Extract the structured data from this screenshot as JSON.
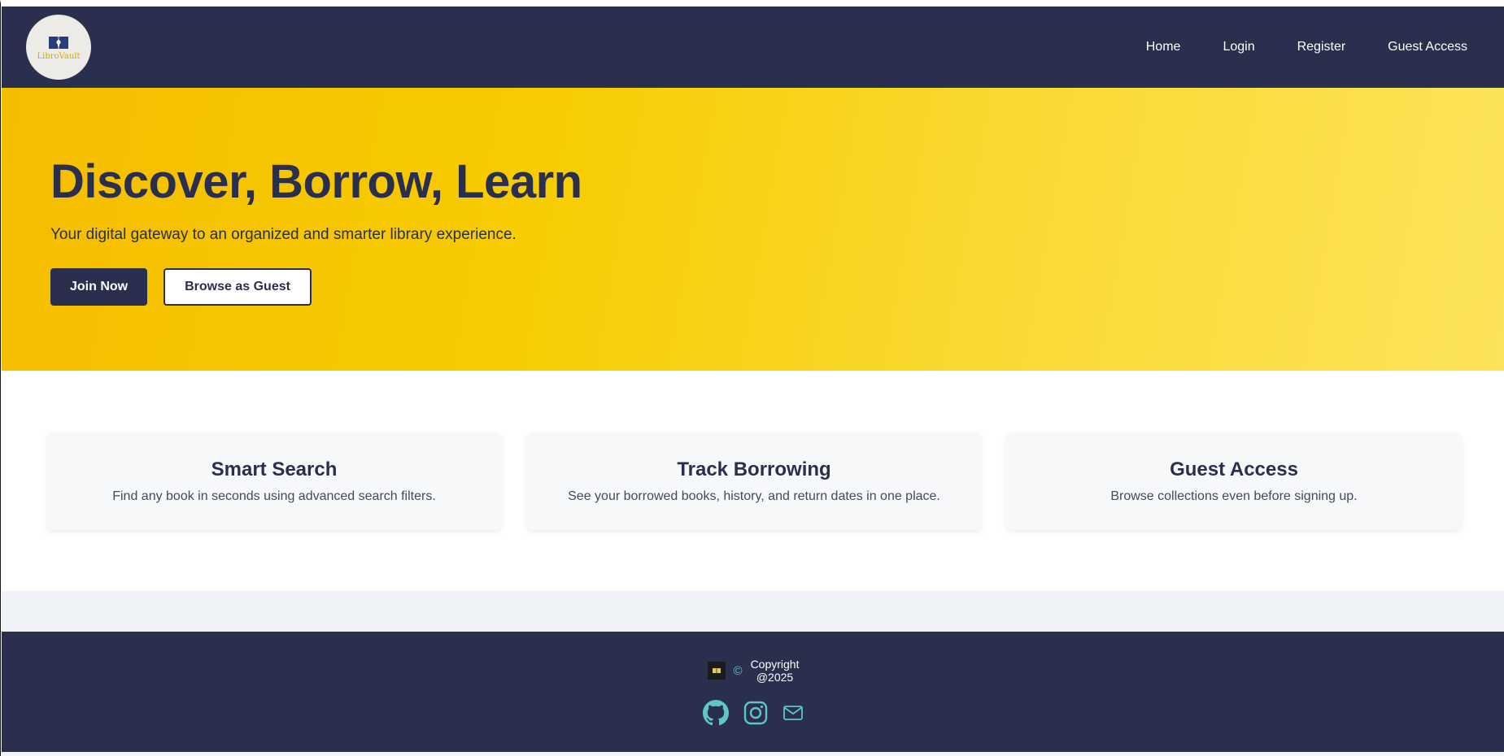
{
  "header": {
    "logo_text": "LibroVault",
    "nav": [
      {
        "label": "Home"
      },
      {
        "label": "Login"
      },
      {
        "label": "Register"
      },
      {
        "label": "Guest Access"
      }
    ]
  },
  "hero": {
    "title": "Discover, Borrow, Learn",
    "subtitle": "Your digital gateway to an organized and smarter library experience.",
    "primary_button": "Join Now",
    "secondary_button": "Browse as Guest"
  },
  "features": [
    {
      "title": "Smart Search",
      "text": "Find any book in seconds using advanced search filters."
    },
    {
      "title": "Track Borrowing",
      "text": "See your borrowed books, history, and return dates in one place."
    },
    {
      "title": "Guest Access",
      "text": "Browse collections even before signing up."
    }
  ],
  "footer": {
    "copyright_symbol": "©",
    "copyright_line1": "Copyright",
    "copyright_line2": "@2025",
    "icons": [
      "github-icon",
      "instagram-icon",
      "mail-icon"
    ]
  },
  "colors": {
    "navy": "#2b2f4e",
    "yellow": "#f7cc00",
    "teal": "#5ec6c6"
  }
}
